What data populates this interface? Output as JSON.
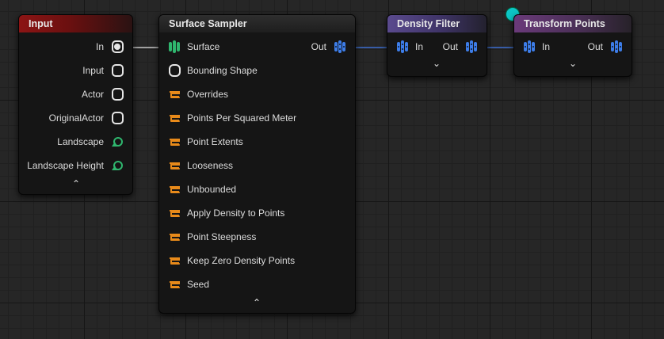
{
  "colors": {
    "input_header": "#8c1414",
    "density_filter_header": "#5a4a8e",
    "transform_points_header": "#6a3a7a",
    "points_pin": "#3d7de8",
    "surface_pin": "#2fb66e",
    "property_pin": "#e88a1a",
    "landscape_pin": "#2fb66e",
    "wire": "#3d6fd0",
    "reroute": "#0cc6c6"
  },
  "nodes": {
    "input": {
      "title": "Input",
      "pins": [
        {
          "label": "In",
          "icon": "any-pin-connected-icon"
        },
        {
          "label": "Input",
          "icon": "any-pin-icon"
        },
        {
          "label": "Actor",
          "icon": "any-pin-icon"
        },
        {
          "label": "OriginalActor",
          "icon": "any-pin-icon"
        },
        {
          "label": "Landscape",
          "icon": "landscape-pin-icon"
        },
        {
          "label": "Landscape Height",
          "icon": "landscape-pin-icon"
        }
      ],
      "collapse": "⌃"
    },
    "surface_sampler": {
      "title": "Surface Sampler",
      "pins": [
        {
          "label": "Surface",
          "icon": "surface-pin-icon"
        },
        {
          "label": "Bounding Shape",
          "icon": "spatial-pin-icon"
        },
        {
          "label": "Overrides",
          "icon": "param-pin-icon"
        },
        {
          "label": "Points Per Squared Meter",
          "icon": "param-pin-icon"
        },
        {
          "label": "Point Extents",
          "icon": "param-pin-icon"
        },
        {
          "label": "Looseness",
          "icon": "param-pin-icon"
        },
        {
          "label": "Unbounded",
          "icon": "param-pin-icon"
        },
        {
          "label": "Apply Density to Points",
          "icon": "param-pin-icon"
        },
        {
          "label": "Point Steepness",
          "icon": "param-pin-icon"
        },
        {
          "label": "Keep Zero Density Points",
          "icon": "param-pin-icon"
        },
        {
          "label": "Seed",
          "icon": "param-pin-icon"
        }
      ],
      "out_label": "Out",
      "collapse": "⌃"
    },
    "density_filter": {
      "title": "Density Filter",
      "in_label": "In",
      "out_label": "Out",
      "expand": "⌄"
    },
    "transform_points": {
      "title": "Transform Points",
      "in_label": "In",
      "out_label": "Out",
      "expand": "⌄"
    }
  }
}
